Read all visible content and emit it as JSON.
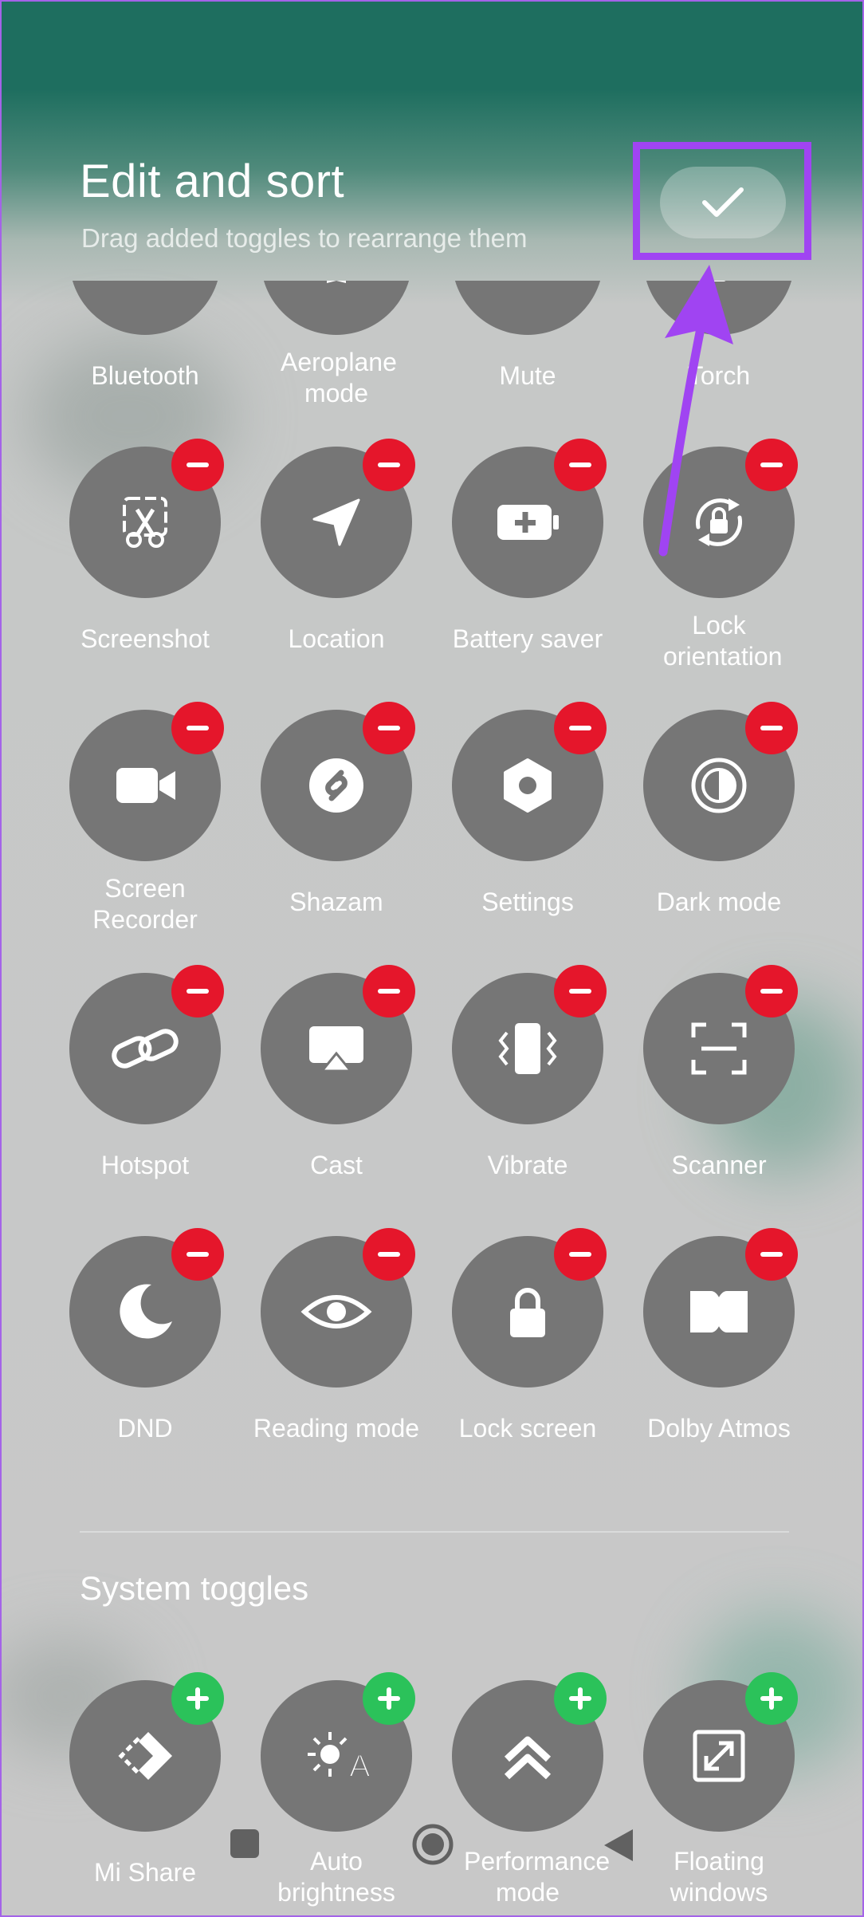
{
  "header": {
    "title": "Edit and sort",
    "subtitle": "Drag added toggles to rearrange them",
    "confirm_icon": "check-icon"
  },
  "added_toggles": [
    {
      "label": "Bluetooth",
      "icon": "bluetooth-icon"
    },
    {
      "label": "Aeroplane mode",
      "icon": "airplane-icon"
    },
    {
      "label": "Mute",
      "icon": "bell-icon"
    },
    {
      "label": "Torch",
      "icon": "torch-icon"
    },
    {
      "label": "Screenshot",
      "icon": "scissors-icon"
    },
    {
      "label": "Location",
      "icon": "location-arrow-icon"
    },
    {
      "label": "Battery saver",
      "icon": "battery-plus-icon"
    },
    {
      "label": "Lock orientation",
      "icon": "rotation-lock-icon"
    },
    {
      "label": "Screen Recorder",
      "icon": "video-camera-icon"
    },
    {
      "label": "Shazam",
      "icon": "shazam-icon"
    },
    {
      "label": "Settings",
      "icon": "gear-icon"
    },
    {
      "label": "Dark mode",
      "icon": "contrast-icon"
    },
    {
      "label": "Hotspot",
      "icon": "link-icon"
    },
    {
      "label": "Cast",
      "icon": "cast-icon"
    },
    {
      "label": "Vibrate",
      "icon": "vibrate-icon"
    },
    {
      "label": "Scanner",
      "icon": "scan-icon"
    },
    {
      "label": "DND",
      "icon": "moon-icon"
    },
    {
      "label": "Reading mode",
      "icon": "eye-icon"
    },
    {
      "label": "Lock screen",
      "icon": "padlock-icon"
    },
    {
      "label": "Dolby Atmos",
      "icon": "dolby-icon"
    }
  ],
  "system_section": {
    "title": "System toggles",
    "toggles": [
      {
        "label": "Mi Share",
        "icon": "mi-share-icon"
      },
      {
        "label": "Auto brightness",
        "icon": "auto-brightness-icon"
      },
      {
        "label": "Performance mode",
        "icon": "chevrons-up-icon"
      },
      {
        "label": "Floating windows",
        "icon": "floating-window-icon"
      }
    ]
  },
  "nav_bar": [
    "recents-icon",
    "home-icon",
    "back-icon"
  ],
  "colors": {
    "header_green": "#1e6e5f",
    "tile_gray": "#767676",
    "remove_red": "#e5162b",
    "add_green": "#2bc25a",
    "highlight_purple": "#a044f2"
  }
}
